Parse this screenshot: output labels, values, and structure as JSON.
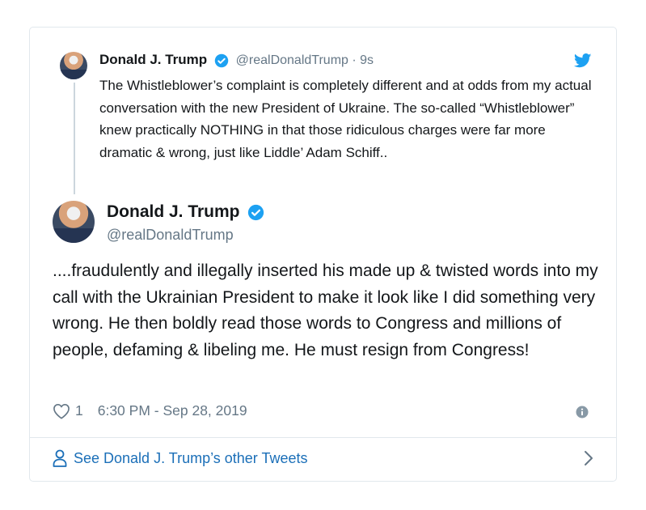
{
  "quoted_tweet": {
    "author_name": "Donald J. Trump",
    "handle_time": "@realDonaldTrump · 9s",
    "text": "The Whistleblower’s complaint is completely different and at odds from my actual conversation with the new President of Ukraine. The so-called “Whistleblower” knew practically NOTHING in that those ridiculous charges were far more dramatic & wrong, just like Liddle’ Adam Schiff.."
  },
  "main_tweet": {
    "author_name": "Donald J. Trump",
    "handle": "@realDonaldTrump",
    "text": "....fraudulently and illegally inserted his made up & twisted words into my call with the Ukrainian President to make it look like I did something very wrong. He then boldly read those words to Congress and millions of people, defaming & libeling me. He must resign from Congress!",
    "likes": "1",
    "timestamp": "6:30 PM - Sep 28, 2019"
  },
  "footer": {
    "label": "See Donald J. Trump’s other Tweets"
  },
  "colors": {
    "verified": "#1da1f2",
    "link": "#1b6fb8",
    "muted": "#657786",
    "border": "#e1e8ed"
  },
  "icons": [
    "verified-badge-icon",
    "twitter-bird-icon",
    "heart-icon",
    "info-icon",
    "person-icon",
    "chevron-right-icon"
  ]
}
